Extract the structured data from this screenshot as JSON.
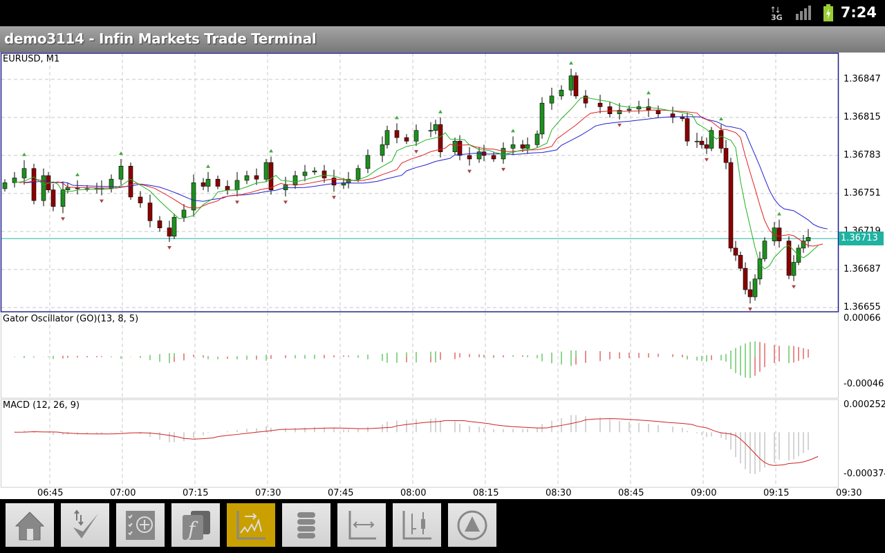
{
  "status_bar": {
    "time": "7:24",
    "network": "3G"
  },
  "title": "demo3114 - Infin Markets Trade Terminal",
  "main_pane": {
    "symbol_label": "EURUSD, M1",
    "current_price": "1.36713"
  },
  "gator_pane": {
    "label": "Gator Oscillator (GO)(13, 8, 5)",
    "axis": [
      "0.00066",
      "-0.00046"
    ]
  },
  "macd_pane": {
    "label": "MACD (12, 26, 9)",
    "axis": [
      "0.000252",
      "-0.000374"
    ]
  },
  "toolbar": [
    {
      "name": "home",
      "icon": "home-icon"
    },
    {
      "name": "trade",
      "icon": "trade-check-icon"
    },
    {
      "name": "add-indicator",
      "icon": "checklist-add-icon"
    },
    {
      "name": "functions",
      "icon": "function-icon"
    },
    {
      "name": "chart-type",
      "icon": "chart-line-icon",
      "active": true
    },
    {
      "name": "menu",
      "icon": "menu-icon"
    },
    {
      "name": "timeframe",
      "icon": "axis-arrow-icon"
    },
    {
      "name": "bars",
      "icon": "candles-icon"
    },
    {
      "name": "up",
      "icon": "up-triangle-icon"
    }
  ],
  "colors": {
    "bull": "#1f8f1f",
    "bear": "#8b0000",
    "jaw": "#2020d0",
    "teeth": "#e02020",
    "lips": "#20b020",
    "price_line": "#20b2a0"
  },
  "chart_data": {
    "type": "candlestick",
    "symbol": "EURUSD",
    "timeframe": "M1",
    "start_time": "06:36",
    "ylim": [
      1.36652,
      1.36869
    ],
    "y_ticks": [
      "1.36847",
      "1.36815",
      "1.36783",
      "1.36751",
      "1.36719",
      "1.36687",
      "1.36655"
    ],
    "x_ticks": [
      "06:45",
      "07:00",
      "07:15",
      "07:30",
      "07:45",
      "08:00",
      "08:15",
      "08:30",
      "08:45",
      "09:00",
      "09:15",
      "09:30"
    ],
    "current_price": 1.36713,
    "points": [
      [
        0,
        1.3676
      ],
      [
        2,
        1.36764
      ],
      [
        4,
        1.36772
      ],
      [
        6,
        1.36745
      ],
      [
        8,
        1.36766
      ],
      [
        9,
        1.36754
      ],
      [
        10,
        1.3674
      ],
      [
        12,
        1.36754
      ],
      [
        13,
        1.36756
      ],
      [
        15,
        1.36755
      ],
      [
        17,
        1.36755
      ],
      [
        19,
        1.36755
      ],
      [
        20,
        1.36755
      ],
      [
        22,
        1.36763
      ],
      [
        24,
        1.36774
      ],
      [
        26,
        1.36748
      ],
      [
        28,
        1.36743
      ],
      [
        30,
        1.36728
      ],
      [
        32,
        1.36722
      ],
      [
        34,
        1.36715
      ],
      [
        35,
        1.36731
      ],
      [
        37,
        1.36737
      ],
      [
        39,
        1.3676
      ],
      [
        41,
        1.36757
      ],
      [
        42,
        1.36763
      ],
      [
        44,
        1.36757
      ],
      [
        46,
        1.36754
      ],
      [
        48,
        1.36762
      ],
      [
        50,
        1.36766
      ],
      [
        52,
        1.36763
      ],
      [
        54,
        1.36777
      ],
      [
        55,
        1.36754
      ],
      [
        58,
        1.36758
      ],
      [
        60,
        1.36766
      ],
      [
        62,
        1.36769
      ],
      [
        64,
        1.3677
      ],
      [
        66,
        1.36764
      ],
      [
        68,
        1.36758
      ],
      [
        70,
        1.3676
      ],
      [
        71,
        1.36763
      ],
      [
        73,
        1.36772
      ],
      [
        75,
        1.36783
      ],
      [
        78,
        1.36792
      ],
      [
        79,
        1.36804
      ],
      [
        81,
        1.36798
      ],
      [
        83,
        1.36795
      ],
      [
        85,
        1.36804
      ],
      [
        88,
        1.36804
      ],
      [
        89,
        1.36809
      ],
      [
        90,
        1.36786
      ],
      [
        93,
        1.36795
      ],
      [
        94,
        1.36783
      ],
      [
        96,
        1.3678
      ],
      [
        98,
        1.36786
      ],
      [
        99,
        1.36783
      ],
      [
        101,
        1.3678
      ],
      [
        103,
        1.36789
      ],
      [
        105,
        1.36792
      ],
      [
        107,
        1.36789
      ],
      [
        108,
        1.36792
      ],
      [
        110,
        1.36801
      ],
      [
        111,
        1.36827
      ],
      [
        113,
        1.36833
      ],
      [
        115,
        1.36838
      ],
      [
        117,
        1.3685
      ],
      [
        118,
        1.36833
      ],
      [
        120,
        1.36827
      ],
      [
        123,
        1.36824
      ],
      [
        125,
        1.36818
      ],
      [
        127,
        1.36821
      ],
      [
        129,
        1.36822
      ],
      [
        131,
        1.36824
      ],
      [
        133,
        1.36821
      ],
      [
        135,
        1.36818
      ],
      [
        138,
        1.36815
      ],
      [
        140,
        1.36814
      ],
      [
        141,
        1.36795
      ],
      [
        143,
        1.36795
      ],
      [
        144,
        1.36792
      ],
      [
        145,
        1.36789
      ],
      [
        146,
        1.36804
      ],
      [
        148,
        1.36789
      ],
      [
        149,
        1.36777
      ],
      [
        150,
        1.36705
      ],
      [
        151,
        1.36699
      ],
      [
        152,
        1.36688
      ],
      [
        153,
        1.3667
      ],
      [
        154,
        1.36664
      ],
      [
        155,
        1.36679
      ],
      [
        156,
        1.36696
      ],
      [
        157,
        1.36711
      ],
      [
        159,
        1.36722
      ],
      [
        160,
        1.36711
      ],
      [
        162,
        1.36682
      ],
      [
        163,
        1.36693
      ],
      [
        164,
        1.36705
      ],
      [
        165,
        1.36711
      ],
      [
        166,
        1.36714
      ]
    ],
    "gator_ylim": [
      -0.00046,
      0.00066
    ],
    "macd_ylim": [
      -0.000374,
      0.000252
    ]
  }
}
